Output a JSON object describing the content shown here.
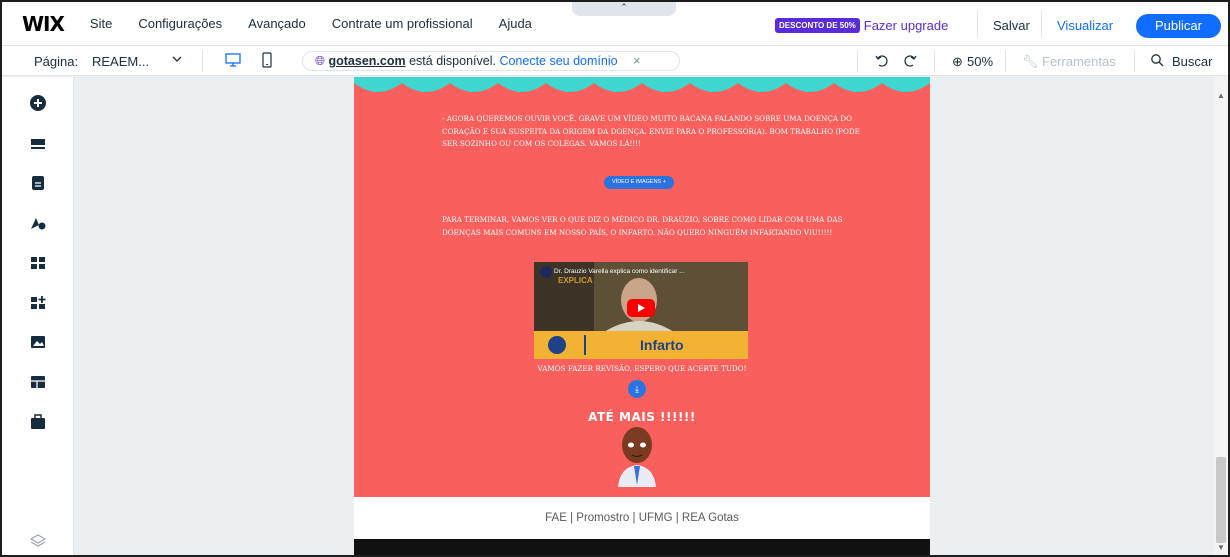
{
  "topbar": {
    "logo": "WIX",
    "menu": [
      "Site",
      "Configurações",
      "Avançado",
      "Contrate um profissional",
      "Ajuda"
    ],
    "collapse": "⌃",
    "discount_badge": "DESCONTO DE 50%",
    "upgrade": "Fazer upgrade",
    "save": "Salvar",
    "preview": "Visualizar",
    "publish": "Publicar"
  },
  "bar2": {
    "page_label": "Página:",
    "page_value": "REAEM...",
    "domain": "gotasen.com",
    "domain_msg": "está disponível.",
    "connect": "Conecte seu domínio",
    "close": "×",
    "zoom": "50%",
    "tools": "Ferramentas",
    "search": "Buscar"
  },
  "page": {
    "para1": "- AGORA QUEREMOS OUVIR VOCÊ. GRAVE UM VÍDEO MUITO BACANA FALANDO SOBRE UMA DOENÇA DO CORAÇÃO E SUA SUSPEITA DA ORIGEM DA DOENÇA. ENVIE PARA O PROFESSOR(A). BOM TRABALHO (PODE SER SOZINHO OU COM OS COLEGAS. VAMOS LÁ!!!!",
    "media_button": "VÍDEO E IMAGENS +",
    "para2": "PARA TERMINAR, VAMOS VER O QUE DIZ O MÉDICO DR. DRAÚZIO, SOBRE COMO LIDAR COM UMA DAS DOENÇAS MAIS COMUNS EM NOSSO PAÍS, O INFARTO. NÃO QUERO NINGUÉM INFARTANDO VIU!!!!!",
    "video_title": "Dr. Drauzio Varella explica como identificar ...",
    "video_overlay": "EXPLICA",
    "video_band": "Infarto",
    "review": "VAMOS FAZER REVISÃO, ESPERO QUE ACERTE TUDO!",
    "goodbye": "ATÉ MAIS !!!!!!",
    "footer": "FAE | Promostro | UFMG | REA Gotas"
  },
  "colors": {
    "accent": "#116dff",
    "upgrade": "#5a2bd8",
    "page_bg": "#f95f5c",
    "wave": "#3fd6d0"
  },
  "icons": {
    "rail": [
      "add-icon",
      "menus-icon",
      "pages-icon",
      "theme-icon",
      "apps-icon",
      "add-apps-icon",
      "media-icon",
      "portfolio-icon",
      "business-icon",
      "layers-icon"
    ]
  }
}
